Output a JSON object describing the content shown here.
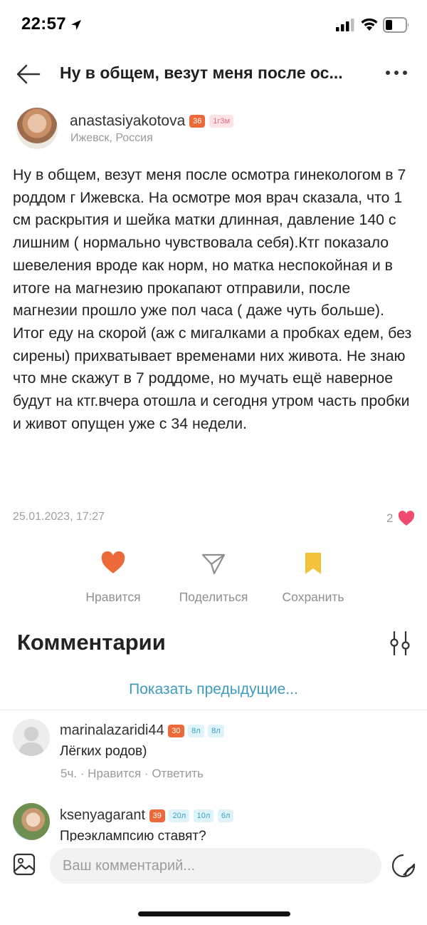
{
  "status": {
    "time": "22:57"
  },
  "header": {
    "title": "Ну в общем, везут меня после ос..."
  },
  "author": {
    "username": "anastasiyakotova",
    "badges": [
      "36",
      "1г3м"
    ],
    "location": "Ижевск, Россия"
  },
  "post": {
    "text": "Ну в общем, везут меня после осмотра гинекологом в  7 роддом г Ижевска. На осмотре моя врач сказала, что 1 см раскрытия и шейка матки длинная, давление 140 с лишним ( нормально чувствовала себя).Ктг показало шевеления вроде как норм, но матка неспокойная и в итоге на магнезию прокапают отправили, после магнезии прошло уже пол часа ( даже чуть больше). Итог еду на скорой (аж с мигалками а пробках едем, без сирены) прихватывает временами них живота. Не знаю что мне скажут в 7 роддоме, но мучать ещё наверное будут на ктг.вчера отошла и сегодня утром часть пробки и живот опущен уже с 34 недели.",
    "date": "25.01.2023, 17:27",
    "likes": "2"
  },
  "actions": {
    "like": "Нравится",
    "share": "Поделиться",
    "save": "Сохранить"
  },
  "comments": {
    "title": "Комментарии",
    "show_previous": "Показать предыдущие...",
    "items": [
      {
        "user": "marinalazaridi44",
        "badges": [
          "30",
          "8л",
          "8л"
        ],
        "text": "Лёгких родов)",
        "time": "5ч.",
        "like": "Нравится",
        "reply": "Ответить"
      },
      {
        "user": "ksenyagarant",
        "badges": [
          "39",
          "20л",
          "10л",
          "6л"
        ],
        "text": "Преэклампсию ставят?"
      }
    ]
  },
  "composer": {
    "placeholder": "Ваш комментарий..."
  },
  "colors": {
    "accent_orange": "#ec6a3a",
    "link_blue": "#3e9bbd",
    "save_yellow": "#f2c33a",
    "heart_pink": "#ef4a6f"
  }
}
